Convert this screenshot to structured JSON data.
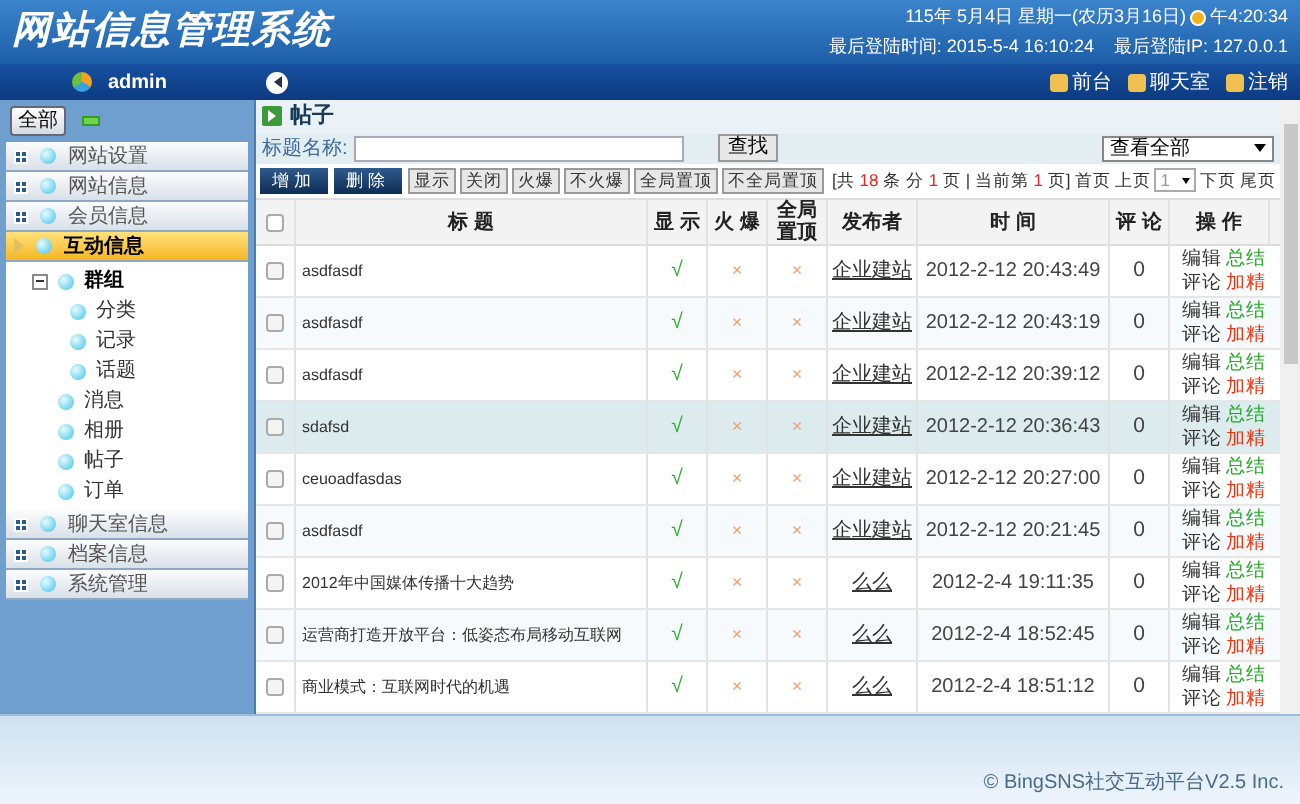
{
  "header": {
    "title": "网站信息管理系统",
    "date": "115年 5月4日 星期一(农历3月16日)",
    "clock": "午4:20:34",
    "last_login_time": "最后登陆时间: 2015-5-4 16:10:24",
    "last_login_ip": "最后登陆IP: 127.0.0.1"
  },
  "nav": {
    "user": "admin",
    "links": [
      "前台",
      "聊天室",
      "注销"
    ]
  },
  "sidebar": {
    "all_button": "全部",
    "items": [
      {
        "label": "网站设置",
        "expanded": false,
        "selected": false
      },
      {
        "label": "网站信息",
        "expanded": false,
        "selected": false
      },
      {
        "label": "会员信息",
        "expanded": false,
        "selected": false
      },
      {
        "label": "互动信息",
        "expanded": true,
        "selected": true,
        "children": [
          {
            "label": "群组",
            "expanded": true,
            "children": [
              {
                "label": "分类"
              },
              {
                "label": "记录"
              },
              {
                "label": "话题"
              }
            ]
          },
          {
            "label": "消息"
          },
          {
            "label": "相册"
          },
          {
            "label": "帖子"
          },
          {
            "label": "订单"
          }
        ]
      },
      {
        "label": "聊天室信息",
        "expanded": false,
        "selected": false
      },
      {
        "label": "档案信息",
        "expanded": false,
        "selected": false
      },
      {
        "label": "系统管理",
        "expanded": false,
        "selected": false
      }
    ]
  },
  "page": {
    "title": "帖子",
    "search_label": "标题名称:",
    "search_button": "查找",
    "filter": "查看全部",
    "buttons": [
      {
        "label": "增加",
        "kind": "primary"
      },
      {
        "label": "删除",
        "kind": "primary"
      },
      {
        "label": "显示",
        "kind": "plain"
      },
      {
        "label": "关闭",
        "kind": "plain"
      },
      {
        "label": "火爆",
        "kind": "plain"
      },
      {
        "label": "不火爆",
        "kind": "plain"
      },
      {
        "label": "全局置顶",
        "kind": "plain"
      },
      {
        "label": "不全局置顶",
        "kind": "plain"
      }
    ],
    "pager": {
      "prefix": "[共",
      "total": "18",
      "mid1": "条 分",
      "pages": "1",
      "mid2": "页 | 当前第",
      "current": "1",
      "suffix": "页]",
      "links_before": [
        "首页",
        "上页"
      ],
      "page_select": "1",
      "links_after": [
        "下页",
        "尾页"
      ]
    }
  },
  "table": {
    "select_all": {
      "checked": false
    },
    "columns": [
      "标 题",
      "显 示",
      "火 爆",
      "全局置顶",
      "发布者",
      "时 间",
      "评 论",
      "操 作"
    ],
    "rows": [
      {
        "title": "asdfasdf",
        "shown": "√",
        "hot": "×",
        "top": "×",
        "author": "企业建站",
        "time": "2012-2-12 20:43:49",
        "comments": "0",
        "selected": false,
        "checked": false,
        "actions": [
          {
            "label": "编辑",
            "color": "#333333"
          },
          {
            "label": "总结",
            "color": "#22aa22"
          },
          {
            "label": "评论",
            "color": "#333333"
          },
          {
            "label": "加精",
            "color": "#ee3311"
          }
        ]
      },
      {
        "title": "asdfasdf",
        "shown": "√",
        "hot": "×",
        "top": "×",
        "author": "企业建站",
        "time": "2012-2-12 20:43:19",
        "comments": "0",
        "selected": false,
        "checked": false,
        "actions": [
          {
            "label": "编辑",
            "color": "#333333"
          },
          {
            "label": "总结",
            "color": "#22aa22"
          },
          {
            "label": "评论",
            "color": "#333333"
          },
          {
            "label": "加精",
            "color": "#ee3311"
          }
        ]
      },
      {
        "title": "asdfasdf",
        "shown": "√",
        "hot": "×",
        "top": "×",
        "author": "企业建站",
        "time": "2012-2-12 20:39:12",
        "comments": "0",
        "selected": false,
        "checked": false,
        "actions": [
          {
            "label": "编辑",
            "color": "#333333"
          },
          {
            "label": "总结",
            "color": "#22aa22"
          },
          {
            "label": "评论",
            "color": "#333333"
          },
          {
            "label": "加精",
            "color": "#ee3311"
          }
        ]
      },
      {
        "title": "sdafsd",
        "shown": "√",
        "hot": "×",
        "top": "×",
        "author": "企业建站",
        "time": "2012-2-12 20:36:43",
        "comments": "0",
        "selected": true,
        "checked": false,
        "actions": [
          {
            "label": "编辑",
            "color": "#333333"
          },
          {
            "label": "总结",
            "color": "#22aa22"
          },
          {
            "label": "评论",
            "color": "#333333"
          },
          {
            "label": "加精",
            "color": "#ee3311"
          }
        ]
      },
      {
        "title": "ceuoadfasdas",
        "shown": "√",
        "hot": "×",
        "top": "×",
        "author": "企业建站",
        "time": "2012-2-12 20:27:00",
        "comments": "0",
        "selected": false,
        "checked": false,
        "actions": [
          {
            "label": "编辑",
            "color": "#333333"
          },
          {
            "label": "总结",
            "color": "#22aa22"
          },
          {
            "label": "评论",
            "color": "#333333"
          },
          {
            "label": "加精",
            "color": "#ee3311"
          }
        ]
      },
      {
        "title": "asdfasdf",
        "shown": "√",
        "hot": "×",
        "top": "×",
        "author": "企业建站",
        "time": "2012-2-12 20:21:45",
        "comments": "0",
        "selected": false,
        "checked": false,
        "actions": [
          {
            "label": "编辑",
            "color": "#333333"
          },
          {
            "label": "总结",
            "color": "#22aa22"
          },
          {
            "label": "评论",
            "color": "#333333"
          },
          {
            "label": "加精",
            "color": "#ee3311"
          }
        ]
      },
      {
        "title": "2012年中国媒体传播十大趋势",
        "shown": "√",
        "hot": "×",
        "top": "×",
        "author": "么么",
        "time": "2012-2-4 19:11:35",
        "comments": "0",
        "selected": false,
        "checked": false,
        "actions": [
          {
            "label": "编辑",
            "color": "#333333"
          },
          {
            "label": "总结",
            "color": "#22aa22"
          },
          {
            "label": "评论",
            "color": "#333333"
          },
          {
            "label": "加精",
            "color": "#ee3311"
          }
        ]
      },
      {
        "title": "运营商打造开放平台：低姿态布局移动互联网",
        "shown": "√",
        "hot": "×",
        "top": "×",
        "author": "么么",
        "time": "2012-2-4 18:52:45",
        "comments": "0",
        "selected": false,
        "checked": false,
        "actions": [
          {
            "label": "编辑",
            "color": "#333333"
          },
          {
            "label": "总结",
            "color": "#22aa22"
          },
          {
            "label": "评论",
            "color": "#333333"
          },
          {
            "label": "加精",
            "color": "#ee3311"
          }
        ]
      },
      {
        "title": "商业模式：互联网时代的机遇",
        "shown": "√",
        "hot": "×",
        "top": "×",
        "author": "么么",
        "time": "2012-2-4 18:51:12",
        "comments": "0",
        "selected": false,
        "checked": false,
        "actions": [
          {
            "label": "编辑",
            "color": "#333333"
          },
          {
            "label": "总结",
            "color": "#22aa22"
          },
          {
            "label": "评论",
            "color": "#333333"
          },
          {
            "label": "加精",
            "color": "#ee3311"
          }
        ]
      }
    ]
  },
  "footer": {
    "copyright": "© BingSNS社交互动平台V2.5 Inc."
  }
}
